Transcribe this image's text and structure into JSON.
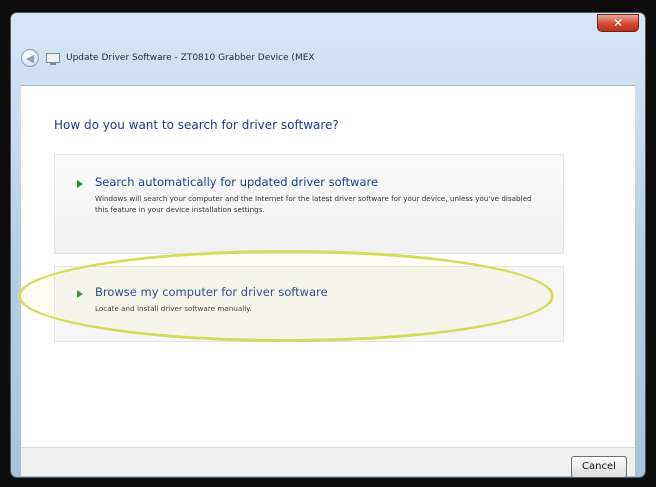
{
  "window": {
    "title": "Update Driver Software - ZT0810 Grabber Device (MEX",
    "close_glyph": "✕"
  },
  "icons": {
    "back": "back-arrow-icon",
    "device": "device-icon",
    "close": "close-icon",
    "option_arrow": "green-arrow-icon"
  },
  "content": {
    "question": "How do you want to search for driver software?",
    "options": [
      {
        "title": "Search automatically for updated driver software",
        "description": "Windows will search your computer and the Internet for the latest driver software for your device, unless you've disabled this feature in your device installation settings."
      },
      {
        "title": "Browse my computer for driver software",
        "description": "Locate and install driver software manually."
      }
    ]
  },
  "footer": {
    "cancel_label": "Cancel"
  },
  "colors": {
    "link_blue": "#1a3c8c",
    "arrow_green": "#2e8b3a",
    "highlight": "#d4dc5a",
    "close_red": "#d24a2e"
  }
}
